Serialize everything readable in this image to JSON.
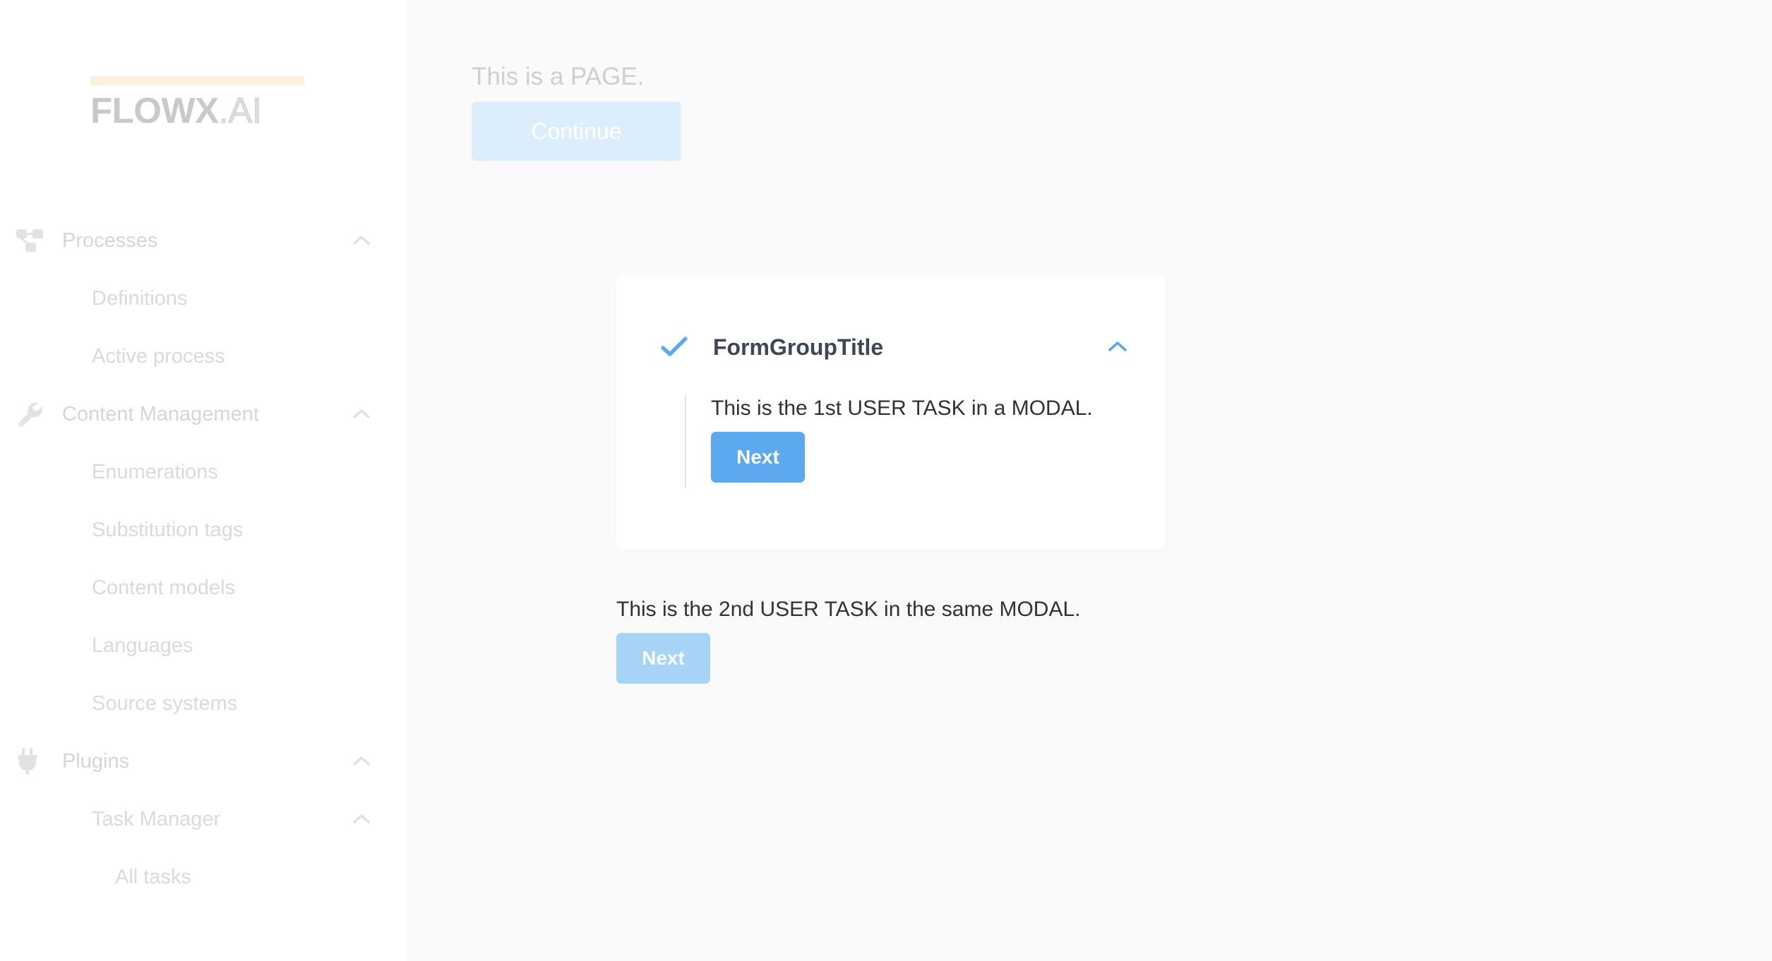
{
  "brand": {
    "logo_main": "FLOWX",
    "logo_suffix": ".AI",
    "accent_bar_color": "#fbf0dc",
    "logo_color": "#c9c9c9"
  },
  "colors": {
    "primary_blue": "#5ca9f0",
    "muted_blue": "#a7d3f7",
    "disabled_blue": "#dcedfb",
    "sidebar_text": "#d6d6d6",
    "card_title": "#3f4756",
    "body_text": "#2f3339",
    "main_bg": "#fafafb",
    "sidebar_bg": "#ffffff"
  },
  "sidebar": {
    "groups": [
      {
        "label": "Processes",
        "icon": "sitemap-icon",
        "expanded": true,
        "chevron": "chevron-up-icon",
        "items": [
          {
            "label": "Definitions"
          },
          {
            "label": "Active process"
          }
        ]
      },
      {
        "label": "Content Management",
        "icon": "wrench-icon",
        "expanded": true,
        "chevron": "chevron-up-icon",
        "items": [
          {
            "label": "Enumerations"
          },
          {
            "label": "Substitution tags"
          },
          {
            "label": "Content models"
          },
          {
            "label": "Languages"
          },
          {
            "label": "Source systems"
          }
        ]
      },
      {
        "label": "Plugins",
        "icon": "plug-icon",
        "expanded": true,
        "chevron": "chevron-up-icon",
        "items": [
          {
            "label": "Task Manager",
            "chevron": "chevron-up-icon",
            "expanded": true
          },
          {
            "label": "All tasks",
            "nested": true
          }
        ]
      }
    ]
  },
  "main": {
    "page_behind": {
      "text": "This is a PAGE.",
      "continue_label": "Continue"
    },
    "modal": {
      "form_group": {
        "check_icon": "check-icon",
        "title": "FormGroupTitle",
        "collapse_icon": "chevron-up-icon",
        "expanded": true,
        "task_text": "This is the 1st USER TASK in a MODAL.",
        "next_label": "Next"
      },
      "second_task": {
        "task_text": "This is the 2nd USER TASK in the same MODAL.",
        "next_label": "Next"
      }
    }
  }
}
